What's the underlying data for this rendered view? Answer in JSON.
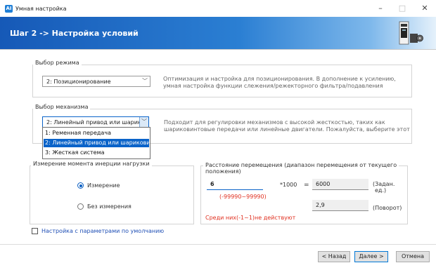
{
  "window": {
    "app_icon_text": "AI",
    "title": "Умная настройка",
    "minimize_glyph": "–",
    "maximize_glyph": "□",
    "close_glyph": "✕"
  },
  "header": {
    "step_title": "Шаг 2 -> Настройка условий",
    "device_icon": "servo-drive-icon"
  },
  "mode": {
    "group_title": "Выбор режима",
    "selected": "2: Позиционирование",
    "description_line1": "Оптимизация и настройка для позиционирования. В дополнение к усилению,",
    "description_line2": "умная настройка функции слежения/режекторного фильтра/подавления"
  },
  "mechanism": {
    "group_title": "Выбор механизма",
    "selected": "2: Линейный привод или шарико",
    "description_line1": "Подходит для регулировки механизмов с высокой жесткостью, таких как",
    "description_line2": "шариковинтовые передачи или линейные двигатели. Пожалуйста, выберите этот",
    "options": [
      "1: Ременная передача",
      "2: Линейный привод или шариковин",
      "3: Жесткая система"
    ],
    "selected_index": 1
  },
  "inertia": {
    "group_title": "Измерение момента инерции нагрузки",
    "option_measure": "Измерение",
    "option_no_measure": "Без измерения",
    "selected": "Измерение"
  },
  "distance": {
    "group_title_line1": "Расстояние перемещения (диапазон перемещения от текущего",
    "group_title_line2": "положения)",
    "input_value": "6",
    "multiplier": "*1000",
    "equals": "=",
    "result_value": "6000",
    "result_unit_line1": "(Задан.",
    "result_unit_line2": "ед.)",
    "range_hint": "(-99990~99990)",
    "rotation_value": "2,9",
    "rotation_unit": "(Поворот)",
    "warning": "Среди них(-1~1)не действуют"
  },
  "defaults_checkbox": {
    "label": "Настройка с параметрами по умолчанию",
    "checked": false
  },
  "footer": {
    "back_label": "< Назад",
    "next_label": "Далее >",
    "cancel_label": "Отмена"
  },
  "colors": {
    "header_dark": "#1659b7",
    "accent": "#0a63c9",
    "warning": "#e03020",
    "link_blue": "#1f4fb5"
  }
}
